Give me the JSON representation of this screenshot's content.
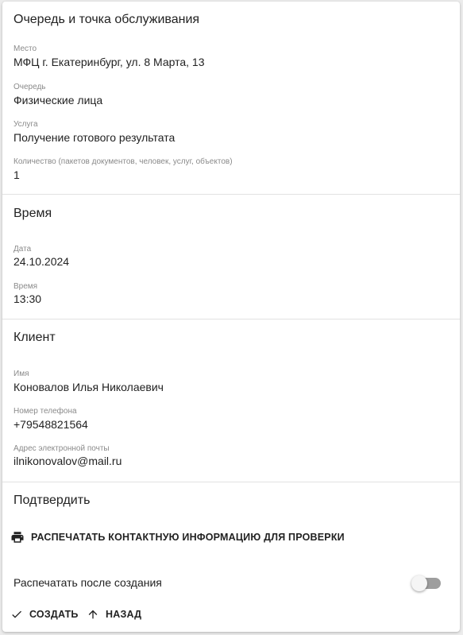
{
  "queue_section": {
    "title": "Очередь и точка обслуживания",
    "fields": [
      {
        "label": "Место",
        "value": "МФЦ г. Екатеринбург, ул. 8 Марта, 13"
      },
      {
        "label": "Очередь",
        "value": "Физические лица"
      },
      {
        "label": "Услуга",
        "value": "Получение готового результата"
      },
      {
        "label": "Количество (пакетов документов, человек, услуг, объектов)",
        "value": "1"
      }
    ]
  },
  "time_section": {
    "title": "Время",
    "fields": [
      {
        "label": "Дата",
        "value": "24.10.2024"
      },
      {
        "label": "Время",
        "value": "13:30"
      }
    ]
  },
  "client_section": {
    "title": "Клиент",
    "fields": [
      {
        "label": "Имя",
        "value": "Коновалов Илья Николаевич"
      },
      {
        "label": "Номер телефона",
        "value": "+79548821564"
      },
      {
        "label": "Адрес электронной почты",
        "value": "ilnikonovalov@mail.ru"
      }
    ]
  },
  "confirm_section": {
    "title": "Подтвердить",
    "print_contact_label": "РАСПЕЧАТАТЬ КОНТАКТНУЮ ИНФОРМАЦИЮ ДЛЯ ПРОВЕРКИ",
    "print_after_label": "Распечатать после создания",
    "print_after_enabled": false,
    "create_label": "СОЗДАТЬ",
    "back_label": "НАЗАД"
  },
  "icons": {
    "print": "printer-icon",
    "create": "check-icon",
    "back": "arrow-up-icon"
  }
}
